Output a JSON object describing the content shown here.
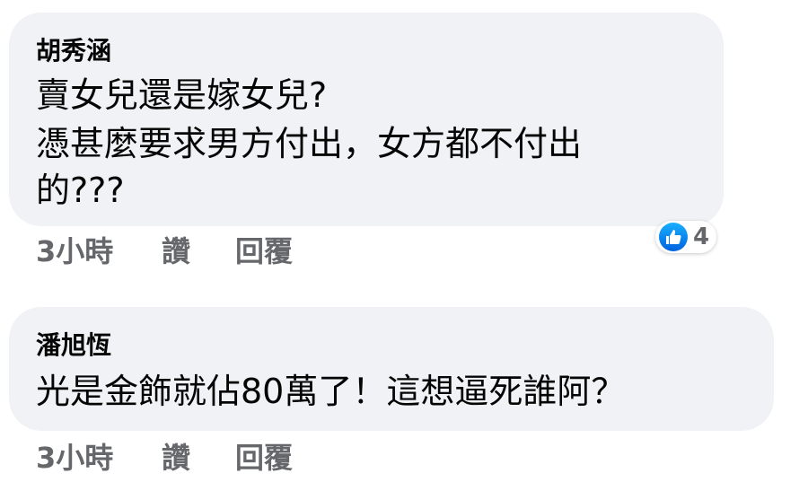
{
  "comments": [
    {
      "author": "胡秀涵",
      "text_lines": [
        "賣女兒還是嫁女兒?",
        "憑甚麼要求男方付出，女方都不付出",
        "的???"
      ],
      "time": "3小時",
      "like_label": "讚",
      "reply_label": "回覆",
      "reaction_count": "4",
      "reaction_icon": "thumbs-up-icon"
    },
    {
      "author": "潘旭恆",
      "text_lines": [
        "光是金飾就佔80萬了！這想逼死誰阿？"
      ],
      "time": "3小時",
      "like_label": "讚",
      "reply_label": "回覆"
    }
  ],
  "colors": {
    "bubble": "#f0f2f5",
    "text": "#050505",
    "secondary": "#65676b",
    "like_blue": "#1877f2"
  }
}
